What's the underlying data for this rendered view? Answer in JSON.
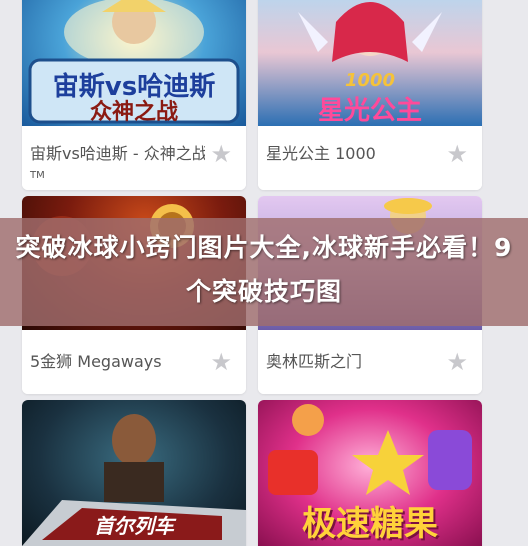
{
  "games": [
    {
      "name": "宙斯vs哈迪斯 - 众神之战",
      "tm": "TM",
      "logo_line1": "宙斯vs哈迪斯",
      "logo_line2": "众神之战",
      "star": "★",
      "favorited": false
    },
    {
      "name": "星光公主 1000",
      "logo_line1": "1000",
      "logo_line2": "星光公主",
      "star": "★",
      "favorited": false
    },
    {
      "name": "5金狮 Megaways",
      "star": "★",
      "favorited": false
    },
    {
      "name": "奥林匹斯之门",
      "star": "★",
      "favorited": false
    },
    {
      "name": "",
      "logo_line1": "首尔列车",
      "star": "★",
      "favorited": false
    },
    {
      "name": "",
      "logo_line1": "极速糖果",
      "star": "★",
      "favorited": false
    }
  ],
  "banner": {
    "title": "突破冰球小窍门图片大全,冰球新手必看！9个突破技巧图"
  },
  "colors": {
    "page_bg": "#e9e9ed",
    "star_inactive": "#c8c8cc",
    "banner_bg": "rgba(160,110,110,0.82)"
  }
}
